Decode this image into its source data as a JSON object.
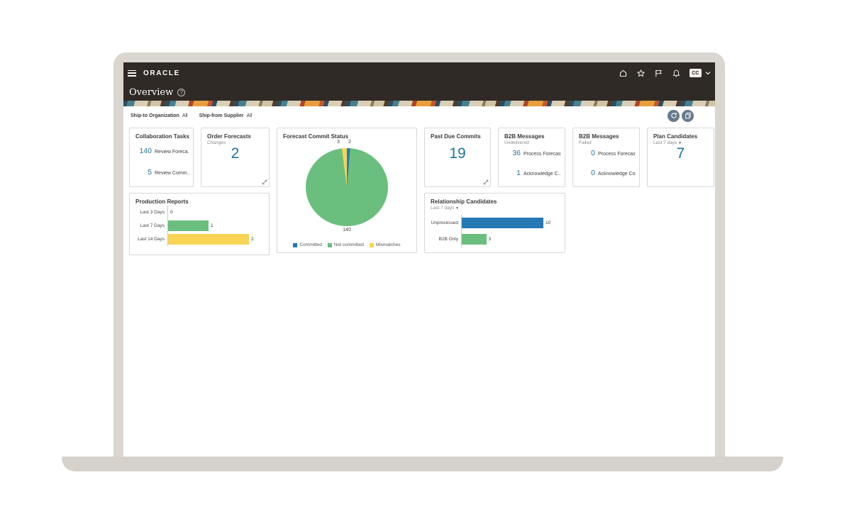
{
  "header": {
    "logo": "ORACLE",
    "page_title": "Overview",
    "help_glyph": "?",
    "avatar_initials": "CC",
    "icons": [
      "hamburger-menu",
      "home",
      "favorites-star",
      "flag",
      "notifications-bell",
      "chevron-down"
    ]
  },
  "filters": {
    "ship_to_label": "Ship-to Organization",
    "ship_to_value": "All",
    "ship_from_label": "Ship-from Supplier",
    "ship_from_value": "All",
    "action_icons": [
      "refresh",
      "manage-infolets"
    ]
  },
  "cards": {
    "collaboration_tasks": {
      "title": "Collaboration Tasks",
      "rows": [
        {
          "value": "140",
          "label": "Review Foreca..."
        },
        {
          "value": "5",
          "label": "Review Comm..."
        }
      ]
    },
    "order_forecasts": {
      "title": "Order Forecasts",
      "subtitle": "Changes",
      "value": "2"
    },
    "forecast_commit_status": {
      "title": "Forecast Commit Status"
    },
    "past_due_commits": {
      "title": "Past Due Commits",
      "value": "19"
    },
    "b2b_messages_undelivered": {
      "title": "B2B Messages",
      "subtitle": "Undelivered",
      "rows": [
        {
          "value": "36",
          "label": "Process Forecasts"
        },
        {
          "value": "1",
          "label": "Acknowledge C..."
        }
      ]
    },
    "b2b_messages_failed": {
      "title": "B2B Messages",
      "subtitle": "Failed",
      "rows": [
        {
          "value": "0",
          "label": "Process Forecasts"
        },
        {
          "value": "0",
          "label": "Acknowledge Co..."
        }
      ]
    },
    "plan_candidates": {
      "title": "Plan Candidates",
      "subtitle": "Last 7 days",
      "value": "7"
    },
    "production_reports": {
      "title": "Production Reports"
    },
    "relationship_candidates": {
      "title": "Relationship Candidates",
      "subtitle": "Last 7 days"
    }
  },
  "chart_data": [
    {
      "type": "pie",
      "title": "Forecast Commit Status",
      "labels": [
        "Committed",
        "Not committed",
        "Mismatches"
      ],
      "values": [
        2,
        140,
        3
      ],
      "colors": [
        "#2779b5",
        "#6abf7e",
        "#f8d355"
      ],
      "legend_position": "bottom",
      "point_labels": {
        "top_left": 3,
        "top_right": 2,
        "bottom": 140
      }
    },
    {
      "type": "bar",
      "orientation": "horizontal",
      "title": "Production Reports",
      "categories": [
        "Last 3 Days",
        "Last 7 Days",
        "Last 14 Days"
      ],
      "values": [
        0,
        1,
        2
      ],
      "colors": [
        "#2779b5",
        "#6abf7e",
        "#f8d355"
      ],
      "xlim": [
        0,
        2.2
      ],
      "value_labels": true
    },
    {
      "type": "bar",
      "orientation": "horizontal",
      "title": "Relationship Candidates",
      "filter": "Last 7 days",
      "categories": [
        "Unprocessed",
        "B2B Only"
      ],
      "values": [
        10,
        3
      ],
      "colors": [
        "#2779b5",
        "#6abf7e"
      ],
      "xlim": [
        0,
        11
      ],
      "value_labels": true
    }
  ],
  "colors": {
    "header_bg": "#2f2a25",
    "accent_number": "#1a759c",
    "bar_blue": "#2779b5",
    "bar_green": "#6abf7e",
    "bar_yellow": "#f8d355",
    "button_slate": "#67798e"
  }
}
